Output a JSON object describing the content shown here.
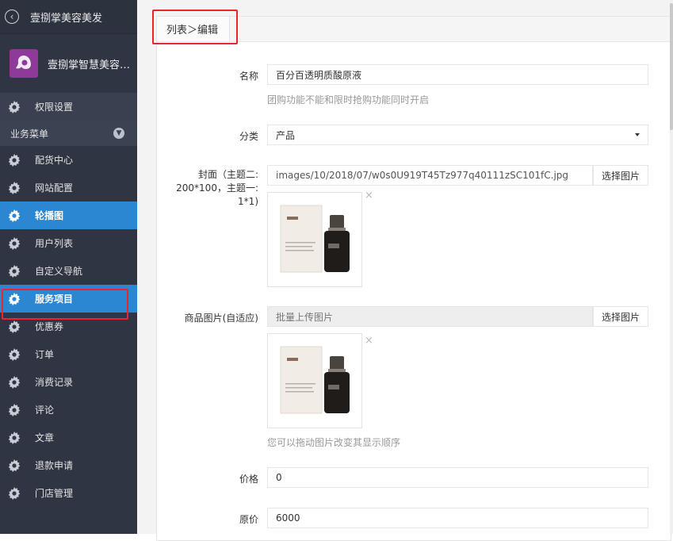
{
  "app": {
    "title": "壹捌掌美容美发"
  },
  "store": {
    "name": "壹捌掌智慧美容美发"
  },
  "sidebar": {
    "top_item": "权限设置",
    "section": "业务菜单",
    "items": [
      {
        "label": "配货中心"
      },
      {
        "label": "网站配置"
      },
      {
        "label": "轮播图"
      },
      {
        "label": "用户列表"
      },
      {
        "label": "自定义导航"
      },
      {
        "label": "服务项目"
      },
      {
        "label": "优惠券"
      },
      {
        "label": "订单"
      },
      {
        "label": "消费记录"
      },
      {
        "label": "评论"
      },
      {
        "label": "文章"
      },
      {
        "label": "退款申请"
      },
      {
        "label": "门店管理"
      }
    ],
    "active_items": [
      "轮播图",
      "服务项目"
    ]
  },
  "breadcrumb": "列表＞编辑",
  "form": {
    "name": {
      "label": "名称",
      "value": "百分百透明质酸原液",
      "hint": "团购功能不能和限时抢购功能同时开启"
    },
    "category": {
      "label": "分类",
      "value": "产品"
    },
    "cover": {
      "label_line1": "封面（主题二:",
      "label_line2": "200*100，主题一:",
      "label_line3": "1*1)",
      "value": "images/10/2018/07/w0s0U919T45Tz977q40111zSC101fC.jpg",
      "button": "选择图片",
      "remove": "×"
    },
    "gallery": {
      "label": "商品图片(自适应)",
      "placeholder": "批量上传图片",
      "button": "选择图片",
      "remove": "×",
      "hint": "您可以拖动图片改变其显示顺序"
    },
    "price": {
      "label": "价格",
      "value": "0"
    },
    "original_price": {
      "label": "原价",
      "value": "6000"
    }
  },
  "colors": {
    "sidebar_bg": "#2f3542",
    "active_bg": "#2b87d1",
    "highlight_border": "#e8262b"
  }
}
